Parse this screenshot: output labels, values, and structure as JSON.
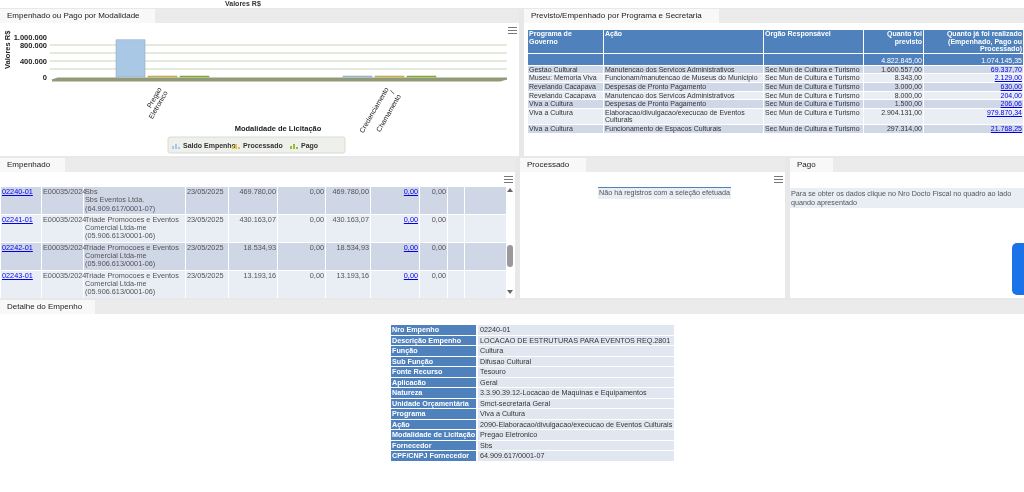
{
  "top_caption": "Valores R$",
  "modalidade_panel": {
    "tab": "Empenhado ou Pago por Modalidade",
    "chart_data": {
      "type": "bar",
      "xlabel": "Modalidade de Licitação",
      "ylabel": "Valores R$",
      "categories": [
        "Pregao Eletronico",
        "Credenciamento / Chamamento"
      ],
      "series": [
        {
          "name": "Saldo Empenho",
          "color": "#a9c8e6",
          "values": [
            930000,
            0
          ]
        },
        {
          "name": "Processado",
          "color": "#e6be4e",
          "values": [
            0,
            0
          ]
        },
        {
          "name": "Pago",
          "color": "#97bc3a",
          "values": [
            0,
            0
          ]
        }
      ],
      "legend": "bottom",
      "ylim": [
        0,
        1000000
      ],
      "yticks": [
        {
          "value": 0,
          "label": "0"
        },
        {
          "value": 400000,
          "label": "400.000"
        },
        {
          "value": 800000,
          "label": "800.000"
        },
        {
          "value": 1000000,
          "label": "1.000.000"
        }
      ]
    }
  },
  "programa_panel": {
    "tab": "Previsto/Empenhado por Programa e Secretaria",
    "table": {
      "columns": [
        "Programa de Governo",
        "Ação",
        "Órgão Responsável",
        "Quanto foi previsto",
        "Quanto já foi realizado (Empenhado, Pago ou Processado)"
      ],
      "totals": {
        "previsto": "4.822.845,00",
        "realizado": "1.074.145,35"
      },
      "rows": [
        [
          "Gestao Cultural",
          "Manutencao dos Servicos Administrativos",
          "Sec Mun de Cultura e Turismo",
          "1.600.557,00",
          "69.337,70"
        ],
        [
          "Museu: Memoria Viva",
          "Funcionam/manutencao de Museus do Municipio",
          "Sec Mun de Cultura e Turismo",
          "8.343,00",
          "2.129,00"
        ],
        [
          "Revelando Cacapava",
          "Despesas de Pronto Pagamento",
          "Sec Mun de Cultura e Turismo",
          "3.000,00",
          "630,00"
        ],
        [
          "Revelando Cacapava",
          "Manutencao dos Servicos Administrativos",
          "Sec Mun de Cultura e Turismo",
          "8.000,00",
          "204,00"
        ],
        [
          "Viva a Cultura",
          "Despesas de Pronto Pagamento",
          "Sec Mun de Cultura e Turismo",
          "1.500,00",
          "206,06"
        ],
        [
          "Viva a Cultura",
          "Elaboracao/divulgacao/execucao de Eventos Culturais",
          "Sec Mun de Cultura e Turismo",
          "2.904.131,00",
          "979.870,34"
        ],
        [
          "Viva a Cultura",
          "Funcionamento de Espacos Culturais",
          "Sec Mun de Cultura e Turismo",
          "297.314,00",
          "21.768,25"
        ]
      ]
    }
  },
  "empenhado_panel": {
    "tab": "Empenhado",
    "rows": [
      {
        "empenho": "02240-01",
        "processo": "E00035/2024",
        "fornecedor": [
          "Sbs",
          "Sbs Eventos Ltda.",
          "(64.909.617/0001-07)"
        ],
        "data": "23/05/2025",
        "column_5": "469.780,00",
        "column_6": "0,00",
        "column_7": "469.780,00",
        "column_8": "0,00",
        "column_9": "0,00"
      },
      {
        "empenho": "02241-01",
        "processo": "E00035/2024",
        "fornecedor": [
          "Triade Promocoes e Eventos Comercial Ltda-me",
          "(05.906.613/0001-06)"
        ],
        "data": "23/05/2025",
        "column_5": "430.163,07",
        "column_6": "0,00",
        "column_7": "430.163,07",
        "column_8": "0,00",
        "column_9": "0,00"
      },
      {
        "empenho": "02242-01",
        "processo": "E00035/2024",
        "fornecedor": [
          "Triade Promocoes e Eventos Comercial Ltda-me",
          "(05.906.613/0001-06)"
        ],
        "data": "23/05/2025",
        "column_5": "18.534,93",
        "column_6": "0,00",
        "column_7": "18.534,93",
        "column_8": "0,00",
        "column_9": "0,00"
      },
      {
        "empenho": "02243-01",
        "processo": "E00035/2024",
        "fornecedor": [
          "Triade Promocoes e Eventos Comercial Ltda-me",
          "(05.906.613/0001-06)"
        ],
        "data": "23/05/2025",
        "column_5": "13.193,16",
        "column_6": "0,00",
        "column_7": "13.193,16",
        "column_8": "0,00",
        "column_9": "0,00"
      }
    ]
  },
  "processado_panel": {
    "tab": "Processado",
    "message": "Não há registros com a seleção efetuada"
  },
  "pago_panel": {
    "tab": "Pago",
    "message": "Para se obter os dados clique no Nro Docto Fiscal no quadro ao lado quando apresentado"
  },
  "detalhe_panel": {
    "tab": "Detalhe do Empenho",
    "fields": [
      {
        "label": "Nro Empenho",
        "value": "02240-01"
      },
      {
        "label": "Descrição Empenho",
        "value": "LOCACAO DE ESTRUTURAS PARA EVENTOS REQ.2801"
      },
      {
        "label": "Função",
        "value": "Cultura"
      },
      {
        "label": "Sub Função",
        "value": "Difusao Cultural"
      },
      {
        "label": "Fonte Recurso",
        "value": "Tesouro"
      },
      {
        "label": "Aplicacão",
        "value": "Geral"
      },
      {
        "label": "Natureza",
        "value": "3.3.90.39.12-Locacao de Maquinas e Equipamentos"
      },
      {
        "label": "Unidade Orçamentária",
        "value": "Smct-secretaria Geral"
      },
      {
        "label": "Programa",
        "value": "Viva a Cultura"
      },
      {
        "label": "Ação",
        "value": "2090-Elaboracao/divulgacao/execucao de Eventos Culturais"
      },
      {
        "label": "Modalidade de Licitação",
        "value": "Pregao Eletronico"
      },
      {
        "label": "Fornecedor",
        "value": "Sbs"
      },
      {
        "label": "CPF/CNPJ Fornecedor",
        "value": "64.909.617/0001-07"
      }
    ]
  }
}
